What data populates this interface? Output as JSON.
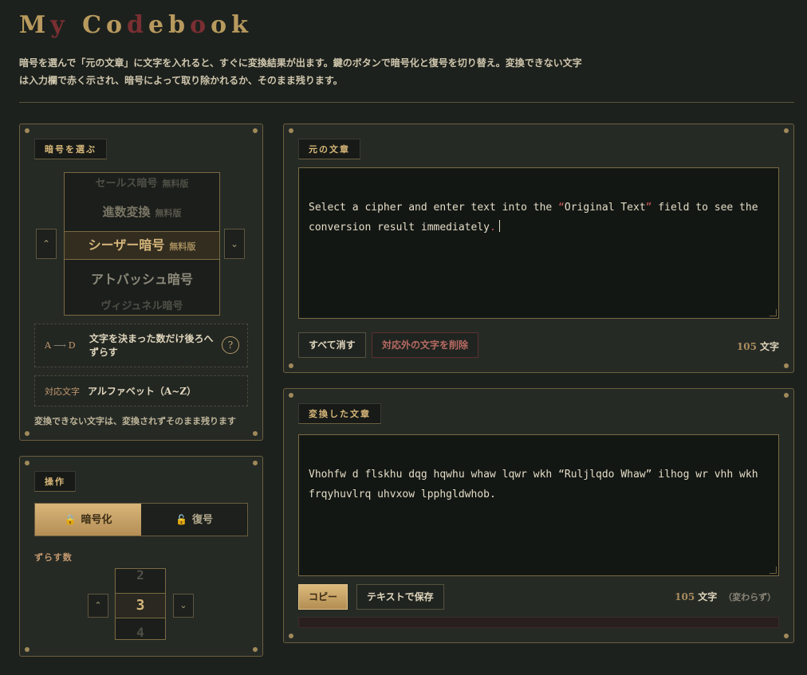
{
  "app": {
    "title_parts": [
      {
        "t": "M",
        "red": false
      },
      {
        "t": "y",
        "red": true
      },
      {
        "t": " ",
        "red": false
      },
      {
        "t": "C",
        "red": false
      },
      {
        "t": "o",
        "red": false
      },
      {
        "t": "d",
        "red": true
      },
      {
        "t": "e",
        "red": false
      },
      {
        "t": "b",
        "red": false
      },
      {
        "t": "o",
        "red": true
      },
      {
        "t": "o",
        "red": false
      },
      {
        "t": "k",
        "red": false
      }
    ],
    "description": "暗号を選んで「元の文章」に文字を入れると、すぐに変換結果が出ます。鍵のボタンで暗号化と復号を切り替え。変換できない文字は入力欄で赤く示され、暗号によって取り除かれるか、そのまま残ります。"
  },
  "cipher_panel": {
    "label": "暗号を選ぶ",
    "items": [
      {
        "name": "セールス暗号",
        "badge": "無料版"
      },
      {
        "name": "進数変換",
        "badge": "無料版"
      },
      {
        "name": "シーザー暗号",
        "badge": "無料版"
      },
      {
        "name": "アトバッシュ暗号",
        "badge": ""
      },
      {
        "name": "ヴィジュネル暗号",
        "badge": ""
      }
    ],
    "up_glyph": "⌃",
    "down_glyph": "⌄",
    "example_from": "A",
    "example_arrow": "⟶",
    "example_to": "D",
    "summary": "文字を決まった数だけ後ろへずらす",
    "help_glyph": "?",
    "charset_label": "対応文字",
    "charset_value": "アルファベット（A~Z）",
    "note": "変換できない文字は、変換されずそのまま残ります"
  },
  "operation_panel": {
    "label": "操作",
    "encrypt_label": "暗号化",
    "decrypt_label": "復号",
    "encrypt_icon": "🔒",
    "decrypt_icon": "🔓",
    "mode": "encrypt",
    "shift_label": "ずらす数",
    "shift_prev": "2",
    "shift_value": "3",
    "shift_next": "4",
    "up_glyph": "⌃",
    "down_glyph": "⌄"
  },
  "input_panel": {
    "label": "元の文章",
    "text_before": "Select a cipher and enter text into the ",
    "quote_open": "“",
    "quoted": "Original Text",
    "quote_close": "”",
    "text_after": " field to see the conversion result immediately",
    "text_end": ".",
    "clear_label": "すべて消す",
    "remove_label": "対応外の文字を削除",
    "count": "105",
    "count_unit": "文字"
  },
  "output_panel": {
    "label": "変換した文章",
    "text": "Vhohfw d flskhu dqg hqwhu whaw lqwr wkh “Ruljlqdo Whaw” ilhog wr vhh wkh frqyhuvlrq uhvxow lpphgldwhob.",
    "copy_label": "コピー",
    "save_label": "テキストで保存",
    "count": "105",
    "count_unit": "文字",
    "count_note": "（変わらず）"
  },
  "colors": {
    "background": "#1d211d",
    "gold": "#d4b57a",
    "red_accent": "#7a2f32"
  }
}
